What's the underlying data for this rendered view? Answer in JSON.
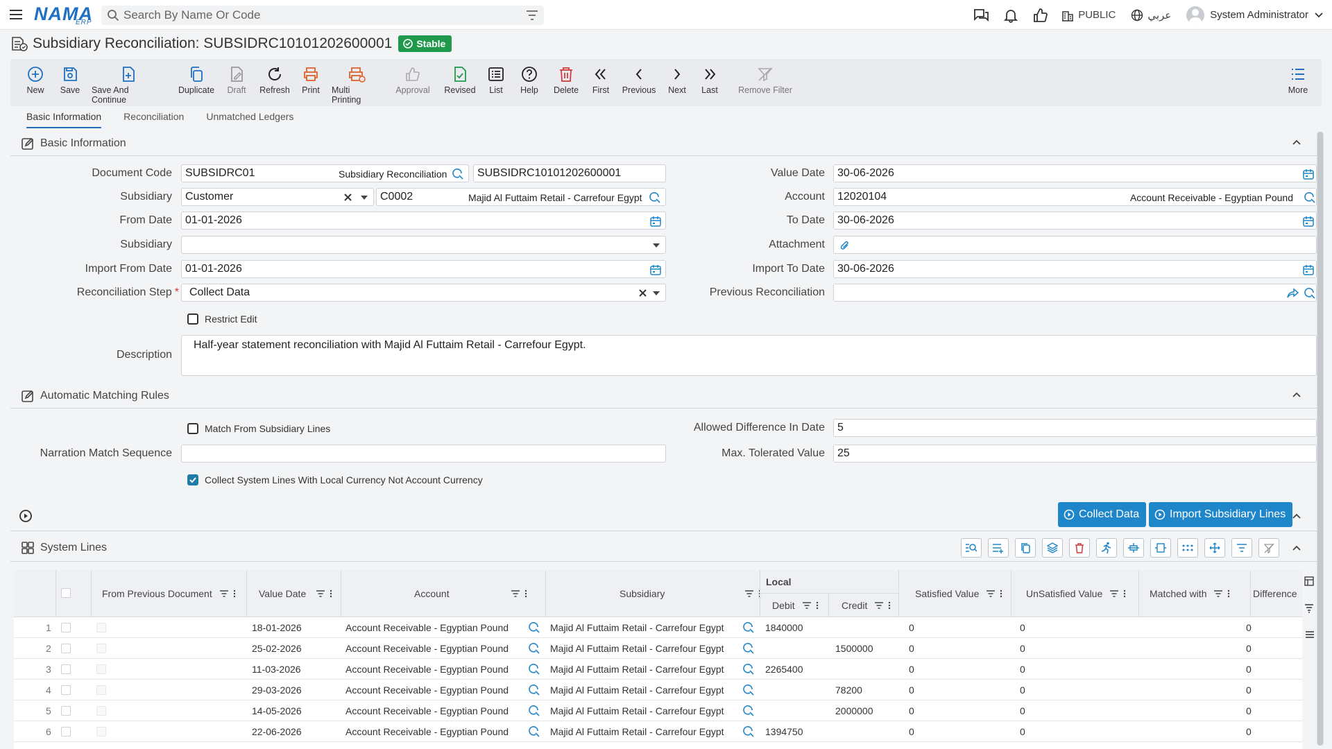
{
  "app": {
    "logo": "NAMA",
    "logo_sub": "ERP"
  },
  "search": {
    "placeholder": "Search By Name Or Code"
  },
  "topbar": {
    "public_label": "PUBLIC",
    "language_label": "عربي",
    "user_name": "System Administrator"
  },
  "title": {
    "text": "Subsidiary Reconciliation: SUBSIDRC10101202600001",
    "status": "Stable"
  },
  "toolbar": {
    "new": "New",
    "save": "Save",
    "save_continue": "Save And Continue",
    "duplicate": "Duplicate",
    "draft": "Draft",
    "refresh": "Refresh",
    "print": "Print",
    "multi_printing": "Multi Printing",
    "approval": "Approval",
    "revised": "Revised",
    "list": "List",
    "help": "Help",
    "delete": "Delete",
    "first": "First",
    "previous": "Previous",
    "next": "Next",
    "last": "Last",
    "remove_filter": "Remove Filter",
    "more": "More"
  },
  "tabs": [
    "Basic Information",
    "Reconciliation",
    "Unmatched Ledgers"
  ],
  "basic": {
    "section_title": "Basic Information",
    "document_code_label": "Document Code",
    "document_code": "SUBSIDRC01",
    "document_type": "Subsidiary Reconciliation",
    "document_number": "SUBSIDRC10101202600001",
    "subsidiary_label": "Subsidiary",
    "subsidiary_type": "Customer",
    "subsidiary_code": "C0002",
    "subsidiary_name": "Majid Al Futtaim Retail - Carrefour Egypt",
    "from_date_label": "From Date",
    "from_date": "01-01-2026",
    "subsidiary2_label": "Subsidiary",
    "subsidiary2_value": "",
    "import_from_label": "Import From Date",
    "import_from": "01-01-2026",
    "step_label": "Reconciliation Step",
    "step_value": "Collect Data",
    "restrict_edit": "Restrict Edit",
    "description_label": "Description",
    "description": "Half-year statement reconciliation with Majid Al Futtaim Retail - Carrefour Egypt.",
    "value_date_label": "Value Date",
    "value_date": "30-06-2026",
    "account_label": "Account",
    "account_code": "12020104",
    "account_name": "Account Receivable - Egyptian Pound",
    "to_date_label": "To Date",
    "to_date": "30-06-2026",
    "attachment_label": "Attachment",
    "import_to_label": "Import To Date",
    "import_to": "30-06-2026",
    "previous_recon_label": "Previous Reconciliation",
    "previous_recon": ""
  },
  "matching": {
    "section_title": "Automatic Matching Rules",
    "match_from_sub": "Match From Subsidiary Lines",
    "narration_label": "Narration Match Sequence",
    "narration_value": "",
    "collect_system_lines": "Collect System Lines With Local Currency Not Account Currency",
    "allowed_diff_label": "Allowed Difference In Date",
    "allowed_diff": "5",
    "max_tolerated_label": "Max. Tolerated Value",
    "max_tolerated": "25"
  },
  "actions": {
    "collect_data": "Collect Data",
    "import_sub_lines": "Import Subsidiary Lines"
  },
  "system_lines": {
    "section_title": "System Lines",
    "headers": {
      "from_prev": "From Previous Document",
      "value_date": "Value Date",
      "account": "Account",
      "subsidiary": "Subsidiary",
      "local": "Local",
      "debit": "Debit",
      "credit": "Credit",
      "satisfied": "Satisfied Value",
      "unsatisfied": "UnSatisfied Value",
      "matched_with": "Matched with",
      "difference": "Difference"
    },
    "rows": [
      {
        "n": "1",
        "date": "18-01-2026",
        "account": "Account Receivable - Egyptian Pound",
        "sub": "Majid Al Futtaim Retail - Carrefour Egypt",
        "debit": "1840000",
        "credit": "",
        "sat": "0",
        "unsat": "0",
        "diff": "0"
      },
      {
        "n": "2",
        "date": "25-02-2026",
        "account": "Account Receivable - Egyptian Pound",
        "sub": "Majid Al Futtaim Retail - Carrefour Egypt",
        "debit": "",
        "credit": "1500000",
        "sat": "0",
        "unsat": "0",
        "diff": "0"
      },
      {
        "n": "3",
        "date": "11-03-2026",
        "account": "Account Receivable - Egyptian Pound",
        "sub": "Majid Al Futtaim Retail - Carrefour Egypt",
        "debit": "2265400",
        "credit": "",
        "sat": "0",
        "unsat": "0",
        "diff": "0"
      },
      {
        "n": "4",
        "date": "29-03-2026",
        "account": "Account Receivable - Egyptian Pound",
        "sub": "Majid Al Futtaim Retail - Carrefour Egypt",
        "debit": "",
        "credit": "78200",
        "sat": "0",
        "unsat": "0",
        "diff": "0"
      },
      {
        "n": "5",
        "date": "14-05-2026",
        "account": "Account Receivable - Egyptian Pound",
        "sub": "Majid Al Futtaim Retail - Carrefour Egypt",
        "debit": "",
        "credit": "2000000",
        "sat": "0",
        "unsat": "0",
        "diff": "0"
      },
      {
        "n": "6",
        "date": "22-06-2026",
        "account": "Account Receivable - Egyptian Pound",
        "sub": "Majid Al Futtaim Retail - Carrefour Egypt",
        "debit": "1394750",
        "credit": "",
        "sat": "0",
        "unsat": "0",
        "diff": "0"
      }
    ]
  },
  "colors": {
    "accent": "#1f6fc3",
    "stable": "#1f9a4d",
    "action": "#1e86c9",
    "orange": "#e0602a",
    "danger": "#d23b3b"
  }
}
